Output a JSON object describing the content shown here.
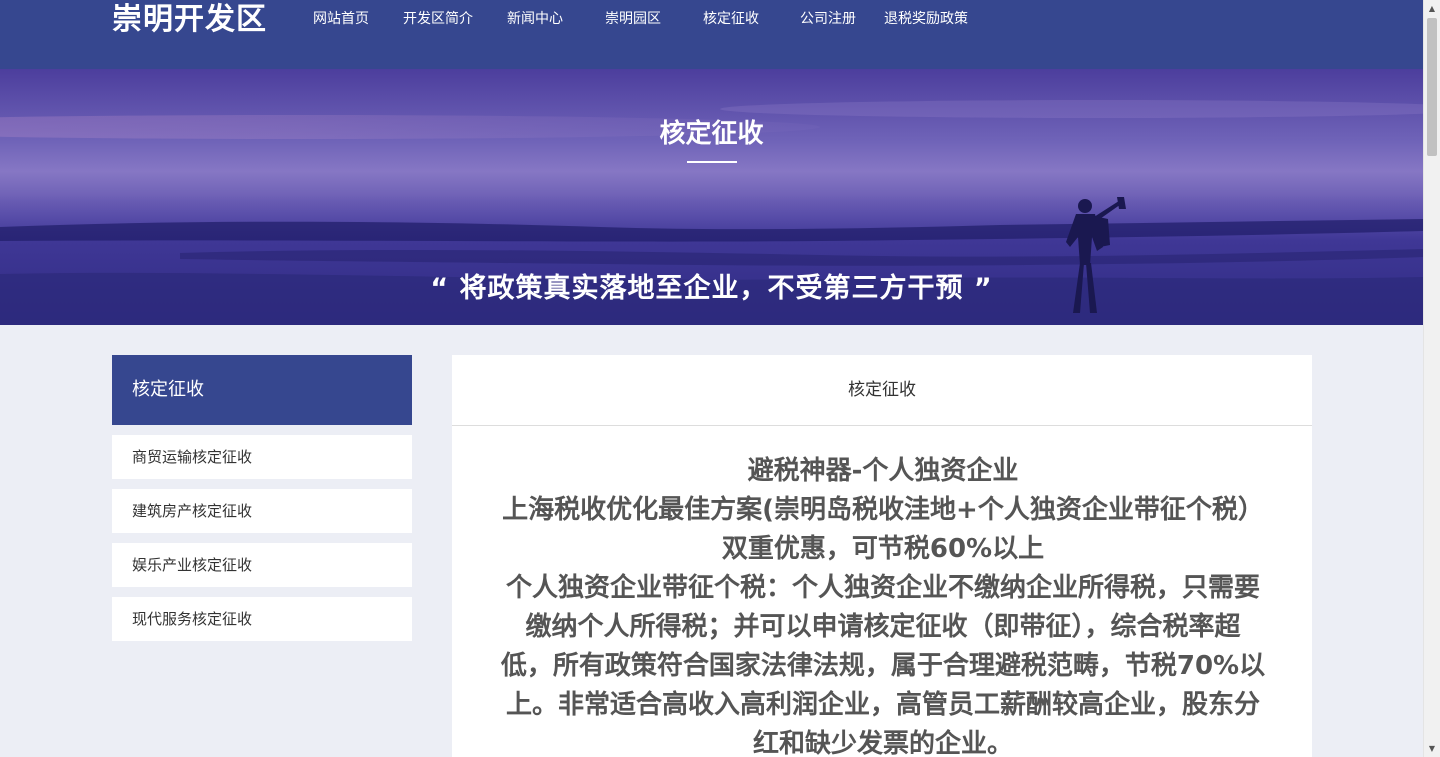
{
  "header": {
    "logo": "崇明开发区",
    "nav": [
      "网站首页",
      "开发区简介",
      "新闻中心",
      "崇明园区",
      "核定征收",
      "公司注册",
      "退税奖励政策"
    ]
  },
  "hero": {
    "title": "核定征收",
    "quote": "“ 将政策真实落地至企业，不受第三方干预 ”"
  },
  "sidebar": {
    "title": "核定征收",
    "items": [
      "商贸运输核定征收",
      "建筑房产核定征收",
      "娱乐产业核定征收",
      "现代服务核定征收"
    ]
  },
  "content": {
    "title": "核定征收",
    "lines": [
      "避税神器-个人独资企业",
      "上海税收优化最佳方案(崇明岛税收洼地+个人独资企业带征个税）",
      "双重优惠，可节税60%以上",
      "个人独资企业带征个税：个人独资企业不缴纳企业所得税，只需要",
      "缴纳个人所得税；并可以申请核定征收（即带征），综合税率超",
      "低，所有政策符合国家法律法规，属于合理避税范畴，节税70%以",
      "上。非常适合高收入高利润企业，高管员工薪酬较高企业，股东分",
      "红和缺少发票的企业。"
    ]
  },
  "colors": {
    "primary": "#36478f",
    "background": "#eceef5",
    "article_text": "#555555"
  }
}
